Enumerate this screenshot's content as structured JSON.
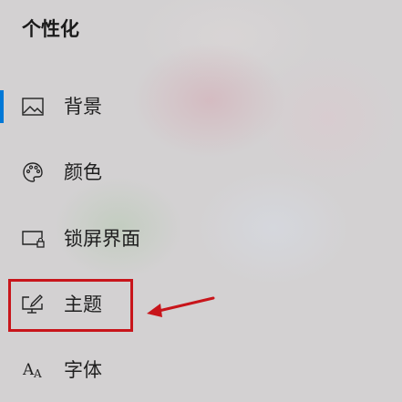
{
  "header": {
    "title": "个性化"
  },
  "nav": {
    "items": [
      {
        "label": "背景",
        "icon": "picture-icon"
      },
      {
        "label": "颜色",
        "icon": "palette-icon"
      },
      {
        "label": "锁屏界面",
        "icon": "lock-screen-icon"
      },
      {
        "label": "主题",
        "icon": "theme-icon"
      },
      {
        "label": "字体",
        "icon": "font-icon"
      }
    ],
    "selected_index": 0
  },
  "annotation": {
    "highlight_color": "#c8151b",
    "accent_color": "#0078d7"
  },
  "watermark": {
    "text": ""
  }
}
